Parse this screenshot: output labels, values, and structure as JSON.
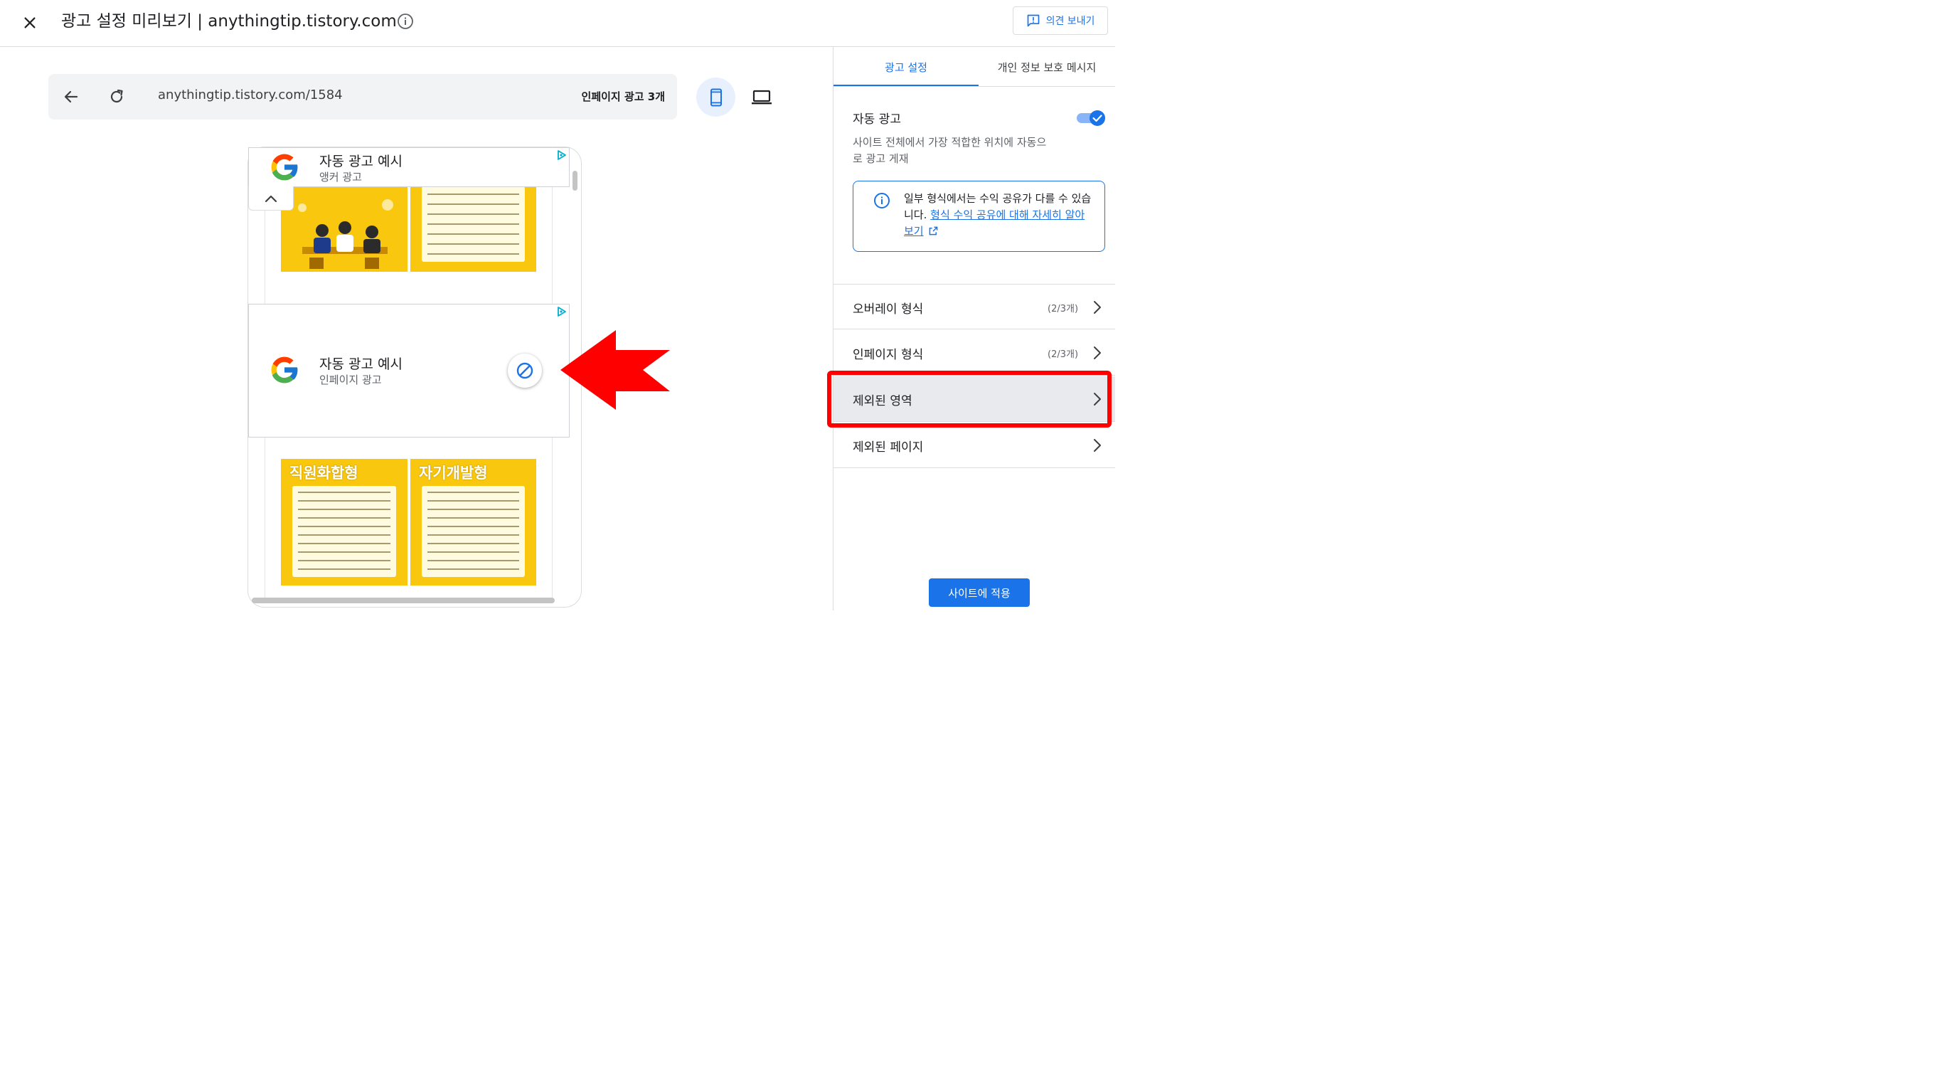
{
  "header": {
    "title": "광고 설정 미리보기 | anythingtip.tistory.com",
    "feedback_label": "의견 보내기"
  },
  "browser": {
    "url": "anythingtip.tistory.com/1584",
    "inpage_ad_count": "인페이지 광고 3개"
  },
  "preview": {
    "anchor_ad": {
      "title": "자동 광고 예시",
      "subtitle": "앵커 광고"
    },
    "inpage_ad": {
      "title": "자동 광고 예시",
      "subtitle": "인페이지 광고"
    },
    "thumbnails": [
      {
        "title": "직원화합형"
      },
      {
        "title": "자기개발형"
      }
    ]
  },
  "panel": {
    "tabs": [
      {
        "label": "광고 설정",
        "active": true
      },
      {
        "label": "개인 정보 보호 메시지",
        "active": false
      }
    ],
    "auto_ads": {
      "label": "자동 광고",
      "enabled": true,
      "description": "사이트 전체에서 가장 적합한 위치에 자동으로 광고 게재"
    },
    "info": {
      "text": "일부 형식에서는 수익 공유가 다를 수 있습니다.",
      "link": "형식 수익 공유에 대해 자세히 알아보기"
    },
    "rows": [
      {
        "label": "오버레이 형식",
        "count": "(2/3개)"
      },
      {
        "label": "인페이지 형식",
        "count": "(2/3개)"
      },
      {
        "label": "제외된 영역",
        "count": ""
      },
      {
        "label": "제외된 페이지",
        "count": ""
      }
    ],
    "apply_label": "사이트에 적용"
  },
  "colors": {
    "accent": "#1a73e8",
    "highlight": "#ff0000",
    "thumbnail_bg": "#f9c80e"
  }
}
